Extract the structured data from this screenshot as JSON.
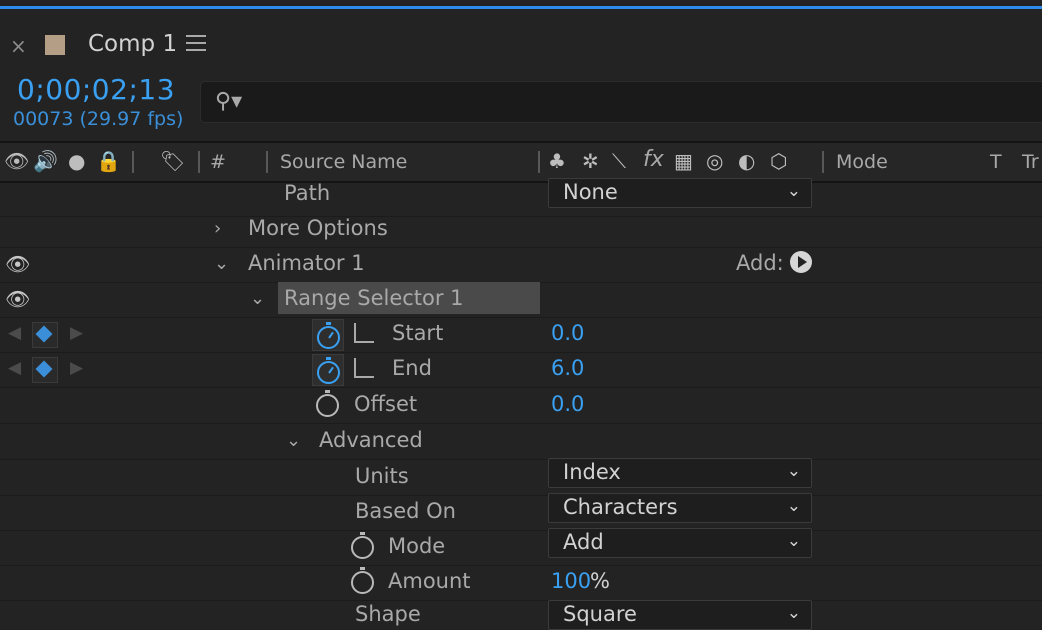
{
  "tab": {
    "close": "×",
    "title": "Comp 1",
    "swatch_color": "#b49f86"
  },
  "time": {
    "timecode": "0;00;02;13",
    "frames": "00073 (29.97 fps)"
  },
  "search": {
    "placeholder": ""
  },
  "columns": {
    "hash": "#",
    "source_name": "Source Name",
    "fx": "fx",
    "mode": "Mode",
    "t": "T",
    "trk": "Tr"
  },
  "rows": {
    "path": {
      "label": "Path",
      "value": "None"
    },
    "more_options": {
      "label": "More Options"
    },
    "animator": {
      "label": "Animator 1",
      "add": "Add:"
    },
    "range_selector": {
      "label": "Range Selector 1"
    },
    "start": {
      "label": "Start",
      "value": "0.0"
    },
    "end": {
      "label": "End",
      "value": "6.0"
    },
    "offset": {
      "label": "Offset",
      "value": "0.0"
    },
    "advanced": {
      "label": "Advanced"
    },
    "units": {
      "label": "Units",
      "value": "Index"
    },
    "based_on": {
      "label": "Based On",
      "value": "Characters"
    },
    "mode": {
      "label": "Mode",
      "value": "Add"
    },
    "amount": {
      "label": "Amount",
      "value": "100",
      "unit": "%"
    },
    "shape": {
      "label": "Shape",
      "value": "Square"
    }
  }
}
